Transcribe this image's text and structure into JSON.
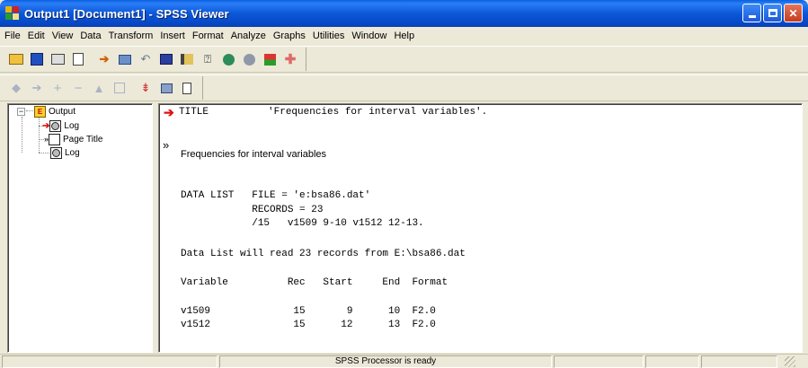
{
  "window": {
    "title": "Output1 [Document1] - SPSS Viewer",
    "controls": {
      "minimize": "minimize",
      "maximize": "maximize",
      "close": "close"
    }
  },
  "menubar": {
    "items": [
      "File",
      "Edit",
      "View",
      "Data",
      "Transform",
      "Insert",
      "Format",
      "Analyze",
      "Graphs",
      "Utilities",
      "Window",
      "Help"
    ]
  },
  "toolbar1": {
    "icons": [
      "open-icon",
      "save-icon",
      "print-icon",
      "print-preview-icon",
      "export-icon",
      "dialog-recall-icon",
      "undo-icon",
      "goto-data-icon",
      "variables-icon",
      "use-sets-icon",
      "chart-icon",
      "pie-icon",
      "spss-data-icon",
      "designate-window-icon"
    ]
  },
  "toolbar2": {
    "icons": [
      "promote-icon",
      "demote-icon",
      "expand-icon",
      "collapse-icon",
      "show-icon",
      "hide-icon",
      "insert-heading-icon",
      "insert-title-icon",
      "insert-text-icon"
    ]
  },
  "tree": {
    "root": "Output",
    "children": [
      "Log",
      "Page Title",
      "Log"
    ]
  },
  "output": {
    "title_cmd": "TITLE          'Frequencies for interval variables'.",
    "page_title_marker": "»",
    "page_title": "Frequencies for interval variables",
    "data_list_lines": [
      "DATA LIST   FILE = 'e:bsa86.dat'",
      "            RECORDS = 23",
      "            /15   v1509 9-10 v1512 12-13."
    ],
    "read_msg": "Data List will read 23 records from E:\\bsa86.dat",
    "table_header": "Variable          Rec   Start     End  Format",
    "table_rows": [
      "v1509              15       9      10  F2.0",
      "v1512              15      12      13  F2.0"
    ]
  },
  "status": {
    "text": "SPSS Processor is ready"
  }
}
